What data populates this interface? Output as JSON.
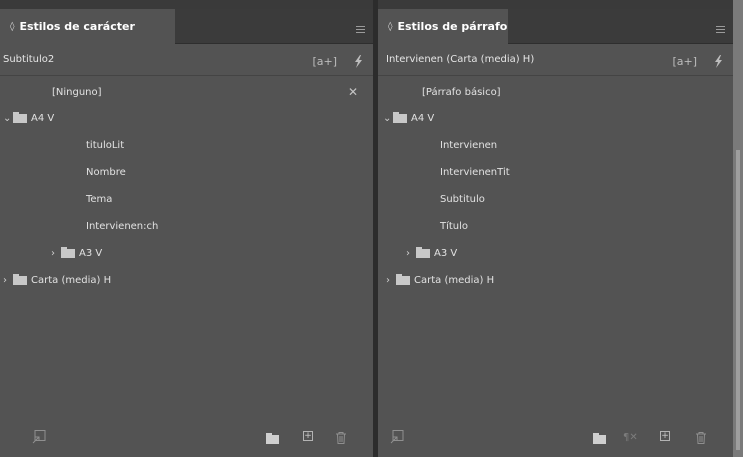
{
  "left_panel": {
    "tab_label": "Estilos de carácter",
    "tab_chevron": "◊",
    "current_style": "Subtitulo2",
    "new_group_label": "[a+]",
    "none_item": "[Ninguno]",
    "tree": {
      "group_a4": "A4 V",
      "items": [
        "tituloLit",
        "Nombre",
        "Tema",
        "Intervienen:ch"
      ],
      "group_a3": "A3 V",
      "group_carta": "Carta (media) H"
    },
    "icons": [
      "panel-menu-icon",
      "bolt-icon",
      "eraser-icon",
      "load-styles-icon",
      "new-folder-icon",
      "new-style-icon",
      "trash-icon"
    ]
  },
  "right_panel": {
    "tab_label": "Estilos de párrafo",
    "tab_chevron": "◊",
    "current_style": "Intervienen (Carta (media) H)",
    "new_group_label": "[a+]",
    "basic_item": "[Párrafo básico]",
    "tree": {
      "group_a4": "A4 V",
      "items": [
        "Intervienen",
        "IntervienenTit",
        "Subtitulo",
        "Título"
      ],
      "group_a3": "A3 V",
      "group_carta": "Carta (media) H"
    },
    "icons": [
      "panel-menu-icon",
      "bolt-icon",
      "load-styles-icon",
      "new-folder-icon",
      "clear-overrides-icon",
      "new-style-icon",
      "trash-icon"
    ]
  },
  "colors": {
    "panel_bg": "#535353",
    "tabbar_bg": "#3b3b3b",
    "divider": "#2c2c2c"
  }
}
